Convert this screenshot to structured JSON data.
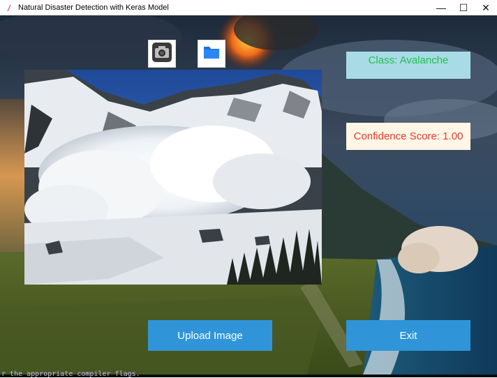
{
  "window": {
    "title": "Natural Disaster Detection with Keras Model",
    "controls": {
      "minimize": "—",
      "maximize": "☐",
      "close": "✕"
    }
  },
  "toolbar": {
    "camera_icon": "camera-icon",
    "folder_icon": "folder-icon"
  },
  "result": {
    "class_label": "Class: Avalanche",
    "confidence_label": "Confidence Score: 1.00"
  },
  "actions": {
    "upload_label": "Upload Image",
    "exit_label": "Exit"
  },
  "terminal": {
    "text": "r the appropriate compiler flags."
  },
  "colors": {
    "class_bg": "#a9dbe6",
    "class_text": "#1fbf50",
    "conf_bg": "#fff6e6",
    "conf_text": "#e03a2e",
    "button_bg": "#2f95d8"
  }
}
